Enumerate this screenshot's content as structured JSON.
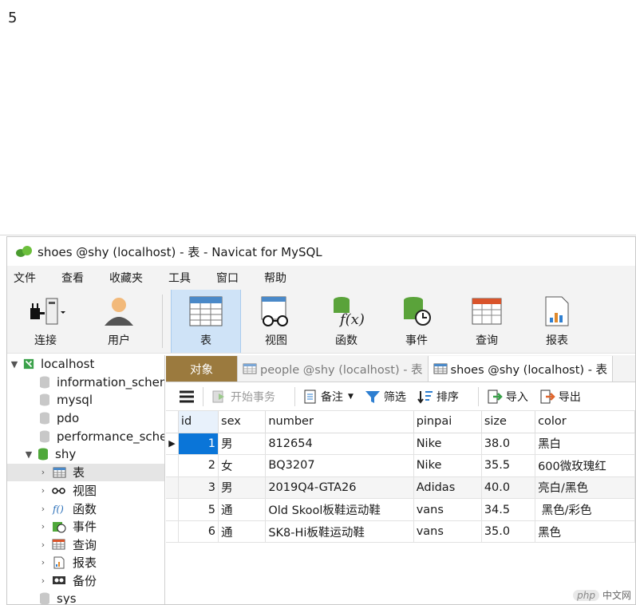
{
  "page_number": "5",
  "window": {
    "title": "shoes @shy (localhost) - 表 - Navicat for MySQL"
  },
  "menu": [
    "文件",
    "查看",
    "收藏夹",
    "工具",
    "窗口",
    "帮助"
  ],
  "toolbar": [
    {
      "label": "连接",
      "icon": "plug-icon"
    },
    {
      "label": "用户",
      "icon": "user-icon"
    },
    {
      "label": "表",
      "icon": "table-icon",
      "active": true
    },
    {
      "label": "视图",
      "icon": "view-icon"
    },
    {
      "label": "函数",
      "icon": "function-icon"
    },
    {
      "label": "事件",
      "icon": "event-icon"
    },
    {
      "label": "查询",
      "icon": "query-icon"
    },
    {
      "label": "报表",
      "icon": "report-icon"
    }
  ],
  "sidebar": {
    "connection": "localhost",
    "databases": [
      "information_schema",
      "mysql",
      "pdo",
      "performance_schema"
    ],
    "open_db": "shy",
    "open_db_items": [
      {
        "label": "表",
        "icon": "table-icon"
      },
      {
        "label": "视图",
        "icon": "view-icon"
      },
      {
        "label": "函数",
        "icon": "function-icon"
      },
      {
        "label": "事件",
        "icon": "event-icon"
      },
      {
        "label": "查询",
        "icon": "query-icon"
      },
      {
        "label": "报表",
        "icon": "report-icon"
      },
      {
        "label": "备份",
        "icon": "backup-icon"
      }
    ],
    "after": [
      "sys"
    ]
  },
  "tabs": [
    {
      "label": "对象"
    },
    {
      "label": "people @shy (localhost) - 表"
    },
    {
      "label": "shoes @shy (localhost) - 表"
    }
  ],
  "subtoolbar": {
    "begin_transaction": "开始事务",
    "memo": "备注",
    "filter": "筛选",
    "sort": "排序",
    "import": "导入",
    "export": "导出"
  },
  "table": {
    "columns": [
      "id",
      "sex",
      "number",
      "pinpai",
      "size",
      "color"
    ],
    "rows": [
      [
        "1",
        "男",
        "812654",
        "Nike",
        "38.0",
        "黑白"
      ],
      [
        "2",
        "女",
        "BQ3207",
        "Nike",
        "35.5",
        "600微玫瑰红"
      ],
      [
        "3",
        "男",
        "2019Q4-GTA26",
        "Adidas",
        "40.0",
        "亮白/黑色"
      ],
      [
        "5",
        "通",
        "Old Skool板鞋运动鞋",
        "vans",
        "34.5",
        " 黑色/彩色"
      ],
      [
        "6",
        "通",
        "SK8-Hi板鞋运动鞋",
        "vans",
        "35.0",
        "黑色"
      ]
    ]
  },
  "watermark": {
    "php": "php",
    "site": "中文网"
  }
}
